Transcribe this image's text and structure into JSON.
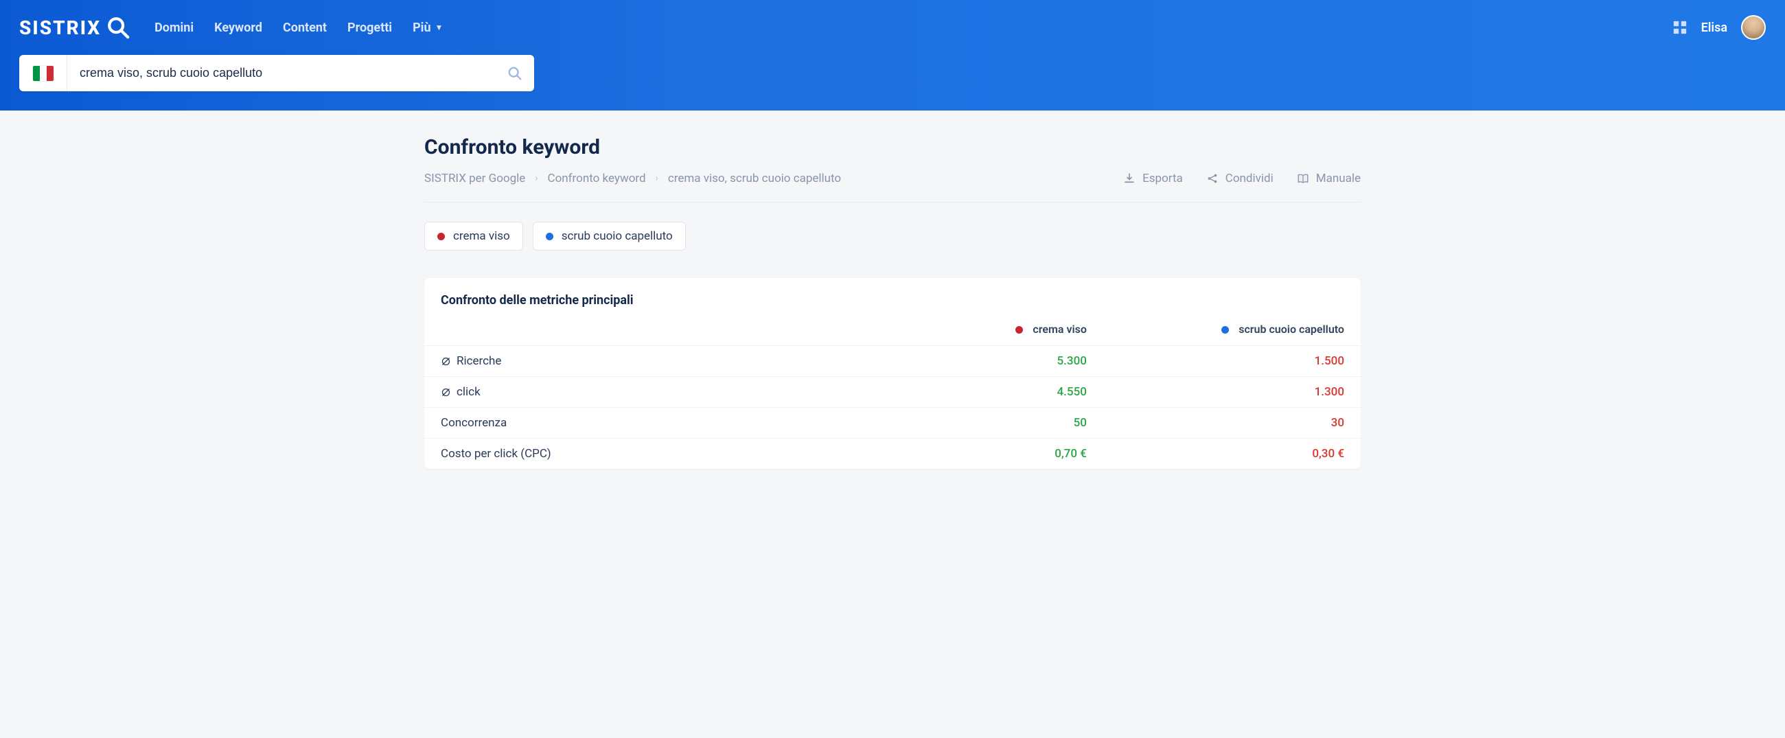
{
  "brand": "SISTRIX",
  "nav": {
    "items": [
      "Domini",
      "Keyword",
      "Content",
      "Progetti"
    ],
    "more": "Più"
  },
  "user": {
    "name": "Elisa"
  },
  "search": {
    "value": "crema viso, scrub cuoio capelluto"
  },
  "page": {
    "title": "Confronto keyword",
    "breadcrumbs": [
      "SISTRIX per Google",
      "Confronto keyword",
      "crema viso, scrub cuoio capelluto"
    ],
    "actions": {
      "export": "Esporta",
      "share": "Condividi",
      "manual": "Manuale"
    }
  },
  "chips": [
    {
      "label": "crema viso",
      "color": "#c9252d"
    },
    {
      "label": "scrub cuoio capelluto",
      "color": "#1e6fe0"
    }
  ],
  "metrics_card": {
    "title": "Confronto delle metriche principali",
    "columns": [
      {
        "label": "crema viso",
        "color": "#c9252d"
      },
      {
        "label": "scrub cuoio capelluto",
        "color": "#1e6fe0"
      }
    ],
    "rows": [
      {
        "label": "Ricerche",
        "diameter": true,
        "values": [
          "5.300",
          "1.500"
        ]
      },
      {
        "label": "click",
        "diameter": true,
        "values": [
          "4.550",
          "1.300"
        ]
      },
      {
        "label": "Concorrenza",
        "diameter": false,
        "values": [
          "50",
          "30"
        ]
      },
      {
        "label": "Costo per click (CPC)",
        "diameter": false,
        "values": [
          "0,70 €",
          "0,30 €"
        ]
      }
    ]
  },
  "chart_data": {
    "type": "table",
    "title": "Confronto delle metriche principali",
    "series": [
      {
        "name": "crema viso",
        "values": {
          "Ricerche": 5300,
          "click": 4550,
          "Concorrenza": 50,
          "CPC_EUR": 0.7
        }
      },
      {
        "name": "scrub cuoio capelluto",
        "values": {
          "Ricerche": 1500,
          "click": 1300,
          "Concorrenza": 30,
          "CPC_EUR": 0.3
        }
      }
    ]
  }
}
